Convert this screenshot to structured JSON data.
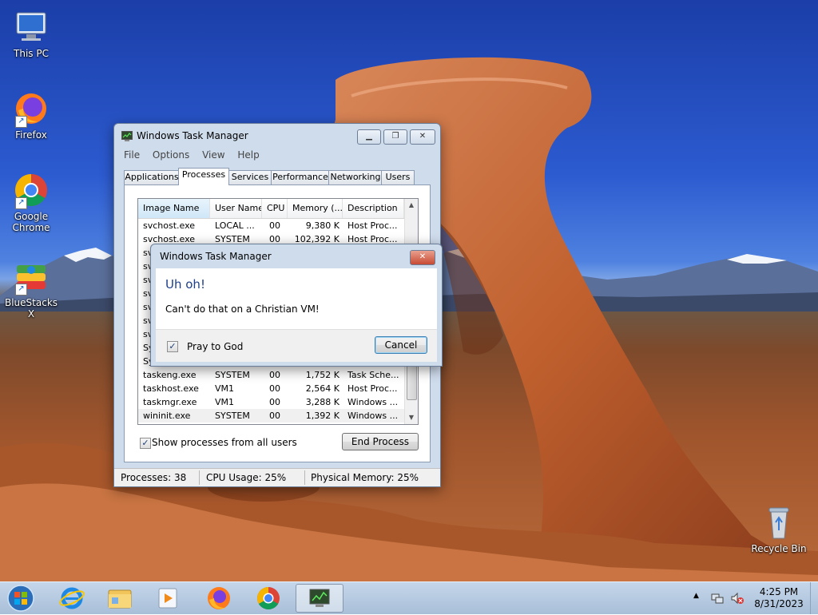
{
  "desktop": {
    "icons": [
      {
        "label": "This PC"
      },
      {
        "label": "Firefox"
      },
      {
        "label": "Google Chrome"
      },
      {
        "label": "BlueStacks X"
      },
      {
        "label": "Recycle Bin"
      }
    ]
  },
  "taskmgr": {
    "title": "Windows Task Manager",
    "caption_minimize": "▁",
    "caption_restore": "❐",
    "caption_close": "✕",
    "menu": [
      "File",
      "Options",
      "View",
      "Help"
    ],
    "tabs": [
      "Applications",
      "Processes",
      "Services",
      "Performance",
      "Networking",
      "Users"
    ],
    "active_tab": "Processes",
    "columns": [
      "Image Name",
      "User Name",
      "CPU",
      "Memory (...",
      "Description"
    ],
    "rows": [
      [
        "svchost.exe",
        "LOCAL ...",
        "00",
        "9,380 K",
        "Host Proc..."
      ],
      [
        "svchost.exe",
        "SYSTEM",
        "00",
        "102,392 K",
        "Host Proc..."
      ],
      [
        "sv",
        "",
        "",
        "",
        ""
      ],
      [
        "sv",
        "",
        "",
        "",
        ""
      ],
      [
        "sv",
        "",
        "",
        "",
        ""
      ],
      [
        "sv",
        "",
        "",
        "",
        ""
      ],
      [
        "sv",
        "",
        "",
        "",
        ""
      ],
      [
        "sv",
        "",
        "",
        "",
        ""
      ],
      [
        "sv",
        "",
        "",
        "",
        ""
      ],
      [
        "Sy",
        "",
        "",
        "",
        ""
      ],
      [
        "Sy",
        "",
        "",
        "",
        ""
      ],
      [
        "taskeng.exe",
        "SYSTEM",
        "00",
        "1,752 K",
        "Task Sche..."
      ],
      [
        "taskhost.exe",
        "VM1",
        "00",
        "2,564 K",
        "Host Proc..."
      ],
      [
        "taskmgr.exe",
        "VM1",
        "00",
        "3,288 K",
        "Windows ..."
      ],
      [
        "wininit.exe",
        "SYSTEM",
        "00",
        "1,392 K",
        "Windows ..."
      ]
    ],
    "scroll_up": "▲",
    "scroll_down": "▼",
    "show_all_label": "Show processes from all users",
    "show_all_checked": true,
    "check_mark": "✓",
    "end_process_label": "End Process",
    "status": {
      "processes": "Processes: 38",
      "cpu": "CPU Usage: 25%",
      "memory": "Physical Memory: 25%"
    }
  },
  "dialog": {
    "title": "Windows Task Manager",
    "close": "✕",
    "heading": "Uh oh!",
    "message": "Can't do that on a Christian VM!",
    "checkbox_label": "Pray to God",
    "checkbox_checked": true,
    "check_mark": "✓",
    "cancel_label": "Cancel"
  },
  "taskbar": {
    "clock_time": "4:25 PM",
    "clock_date": "8/31/2023",
    "tray_arrow": "▲"
  },
  "colors": {
    "dialog_heading": "#1e3f8a",
    "accent": "#3a7bd5"
  }
}
